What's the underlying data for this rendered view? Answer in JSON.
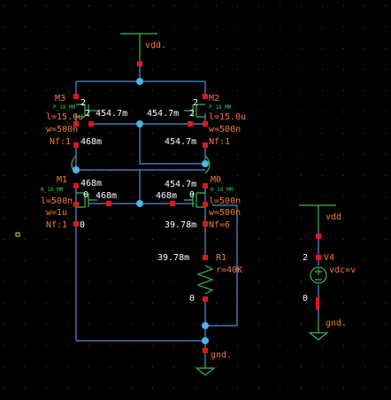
{
  "labels": {
    "vdd_top": "vdd.",
    "gnd_bottom": "gnd.",
    "vdd_right": "vdd",
    "gnd_right": "gnd."
  },
  "m3": {
    "name": "M3",
    "model": "P_18_MM",
    "l": "l=15.0u",
    "w": "w=500n",
    "nf": "Nf:1",
    "pin": "2"
  },
  "m2": {
    "name": "M2",
    "model": "P_18_MM",
    "l": "l=15.0u",
    "w": "w=500n",
    "nf": "Nf:1",
    "pin": "2"
  },
  "m1": {
    "name": "M1",
    "model": "N_18_MM",
    "l": "l=500n",
    "w": "w=1u",
    "nf": "Nf:1",
    "pin": "0"
  },
  "m0": {
    "name": "M0",
    "model": "N_18_MM",
    "l": "l=500n",
    "w": "w=500n",
    "nf": "Nf=6",
    "pin": "0"
  },
  "r1": {
    "name": "R1",
    "r": "r=40K"
  },
  "v4": {
    "name": "V4",
    "vdc": "vdc=v",
    "pin_top": "2",
    "pin_bottom": "0"
  },
  "nodes": {
    "gate_left": "454.7m",
    "gate_right": "454.7m",
    "m3_drain": "468m",
    "m2_drain": "454.7m",
    "m1_drain": "468m",
    "gate_m1": "468m",
    "gate_m0": "468m",
    "m0_drain": "454.7m",
    "m0_source": "39.78m",
    "r1_top": "39.78m",
    "r1_bottom": "0"
  }
}
